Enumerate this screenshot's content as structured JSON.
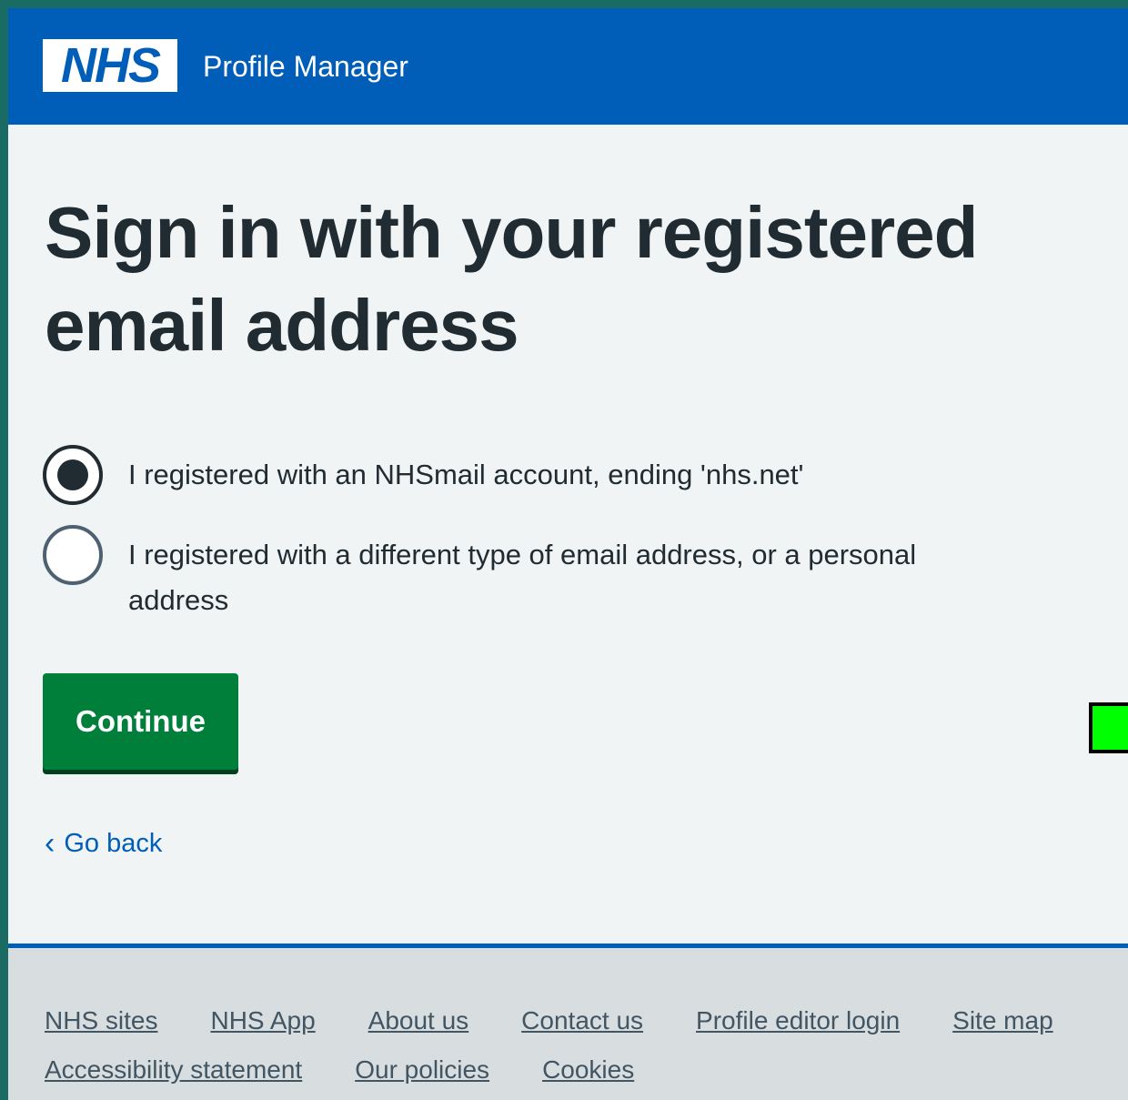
{
  "header": {
    "logo_text": "NHS",
    "service_name": "Profile Manager"
  },
  "page": {
    "title": "Sign in with your registered email address"
  },
  "radios": {
    "option_nhsmail": {
      "label": "I registered with an NHSmail account, ending 'nhs.net'",
      "checked": true
    },
    "option_other": {
      "label": "I registered with a different type of email address, or a personal address",
      "checked": false
    }
  },
  "actions": {
    "continue_label": "Continue",
    "back_label": "Go back"
  },
  "footer": {
    "links": {
      "nhs_sites": "NHS sites",
      "nhs_app": "NHS App",
      "about_us": "About us",
      "contact_us": "Contact us",
      "profile_editor_login": "Profile editor login",
      "site_map": "Site map",
      "accessibility_statement": "Accessibility statement",
      "our_policies": "Our policies",
      "cookies": "Cookies"
    }
  },
  "colors": {
    "header_blue": "#005eb8",
    "button_green": "#007f3b",
    "marker_green": "#00ff00",
    "page_bg": "#f0f4f5",
    "footer_bg": "#d8dde0"
  }
}
